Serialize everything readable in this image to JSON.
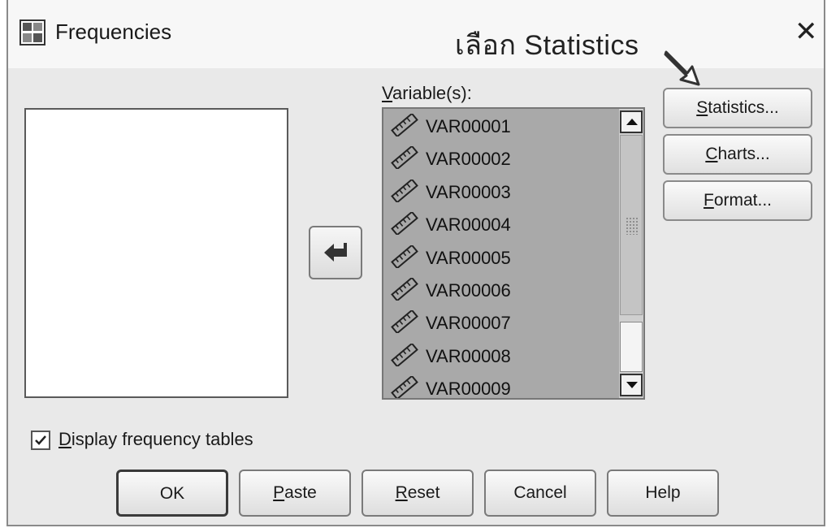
{
  "window": {
    "title": "Frequencies",
    "close_glyph": "✕"
  },
  "annotation": {
    "text": "เลือก Statistics"
  },
  "variables": {
    "label_accel": "V",
    "label_rest": "ariable(s):",
    "items": [
      "VAR00001",
      "VAR00002",
      "VAR00003",
      "VAR00004",
      "VAR00005",
      "VAR00006",
      "VAR00007",
      "VAR00008",
      "VAR00009"
    ]
  },
  "side_buttons": {
    "statistics": {
      "accel": "S",
      "rest": "tatistics..."
    },
    "charts": {
      "accel": "C",
      "rest": "harts..."
    },
    "format": {
      "accel": "F",
      "rest": "ormat..."
    }
  },
  "display_tables": {
    "accel": "D",
    "rest": "isplay frequency tables",
    "checked": true
  },
  "bottom_buttons": {
    "ok": "OK",
    "paste": {
      "accel": "P",
      "rest": "aste"
    },
    "reset": {
      "accel": "R",
      "rest": "eset"
    },
    "cancel": "Cancel",
    "help": "Help"
  },
  "icons": {
    "app": "frequencies-app-icon",
    "move": "move-left-arrow-icon",
    "variable": "scale-ruler-icon",
    "check": "checkmark-icon"
  }
}
